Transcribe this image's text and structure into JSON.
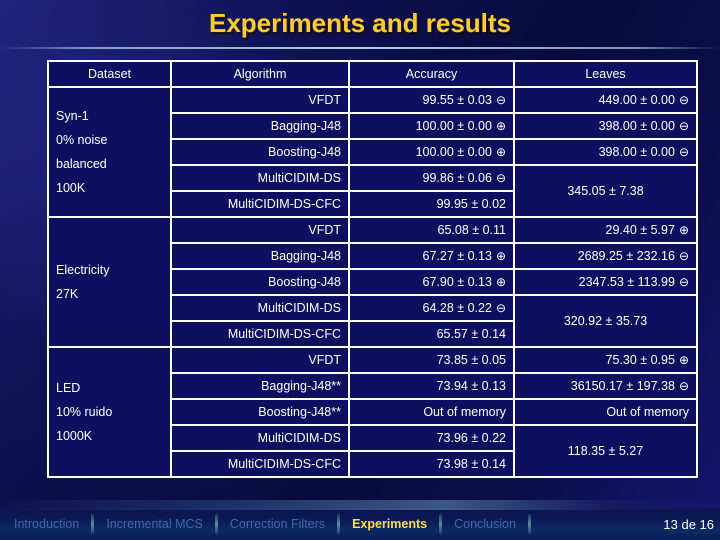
{
  "slide": {
    "title": "Experiments and results",
    "title_color": "#ffcc33",
    "background_color": "#0b0d45",
    "highlight_color": "#0b46ea"
  },
  "table": {
    "headers": [
      "Dataset",
      "Algorithm",
      "Accuracy",
      "Leaves"
    ],
    "groups": [
      {
        "dataset_lines": [
          "Syn-1",
          "0% noise",
          "balanced",
          "100K"
        ],
        "rows": [
          {
            "algorithm": "VFDT",
            "accuracy": "99.55 ± 0.03",
            "accuracy_symbol": "⊖",
            "accuracy_highlighted": false,
            "leaves": "449.00 ± 0.00",
            "leaves_symbol": "⊖"
          },
          {
            "algorithm": "Bagging-J48",
            "accuracy": "100.00 ± 0.00",
            "accuracy_symbol": "⊕",
            "accuracy_highlighted": false,
            "leaves": "398.00 ± 0.00",
            "leaves_symbol": "⊖"
          },
          {
            "algorithm": "Boosting-J48",
            "accuracy": "100.00 ± 0.00",
            "accuracy_symbol": "⊕",
            "accuracy_highlighted": false,
            "leaves": "398.00 ± 0.00",
            "leaves_symbol": "⊖"
          },
          {
            "algorithm": "MultiCIDIM-DS",
            "accuracy": "99.86 ± 0.06",
            "accuracy_symbol": "⊖",
            "accuracy_highlighted": true,
            "leaves": "",
            "leaves_symbol": ""
          },
          {
            "algorithm": "MultiCIDIM-DS-CFC",
            "accuracy": "99.95 ± 0.02",
            "accuracy_symbol": "",
            "accuracy_highlighted": true,
            "leaves": "",
            "leaves_symbol": ""
          }
        ],
        "leaves_merged": "345.05 ± 7.38"
      },
      {
        "dataset_lines": [
          "Electricity",
          "27K"
        ],
        "rows": [
          {
            "algorithm": "VFDT",
            "accuracy": "65.08 ± 0.11",
            "accuracy_symbol": "",
            "accuracy_highlighted": false,
            "leaves": "29.40 ± 5.97",
            "leaves_symbol": "⊕"
          },
          {
            "algorithm": "Bagging-J48",
            "accuracy": "67.27 ± 0.13",
            "accuracy_symbol": "⊕",
            "accuracy_highlighted": false,
            "leaves": "2689.25 ± 232.16",
            "leaves_symbol": "⊖"
          },
          {
            "algorithm": "Boosting-J48",
            "accuracy": "67.90 ± 0.13",
            "accuracy_symbol": "⊕",
            "accuracy_highlighted": false,
            "leaves": "2347.53 ± 113.99",
            "leaves_symbol": "⊖"
          },
          {
            "algorithm": "MultiCIDIM-DS",
            "accuracy": "64.28 ± 0.22",
            "accuracy_symbol": "⊖",
            "accuracy_highlighted": true,
            "leaves": "",
            "leaves_symbol": ""
          },
          {
            "algorithm": "MultiCIDIM-DS-CFC",
            "accuracy": "65.57 ± 0.14",
            "accuracy_symbol": "",
            "accuracy_highlighted": true,
            "leaves": "",
            "leaves_symbol": ""
          }
        ],
        "leaves_merged": "320.92 ± 35.73"
      },
      {
        "dataset_lines": [
          "LED",
          "10% ruido",
          "1000K"
        ],
        "rows": [
          {
            "algorithm": "VFDT",
            "accuracy": "73.85 ± 0.05",
            "accuracy_symbol": "",
            "accuracy_highlighted": false,
            "leaves": "75.30 ± 0.95",
            "leaves_symbol": "⊕"
          },
          {
            "algorithm": "Bagging-J48**",
            "accuracy": "73.94 ± 0.13",
            "accuracy_symbol": "",
            "accuracy_highlighted": false,
            "leaves": "36150.17 ± 197.38",
            "leaves_symbol": "⊖"
          },
          {
            "algorithm": "Boosting-J48**",
            "accuracy": "Out of memory",
            "accuracy_symbol": "",
            "accuracy_highlighted": false,
            "leaves": "Out of memory",
            "leaves_symbol": ""
          },
          {
            "algorithm": "MultiCIDIM-DS",
            "accuracy": "73.96 ± 0.22",
            "accuracy_symbol": "",
            "accuracy_highlighted": true,
            "leaves": "",
            "leaves_symbol": ""
          },
          {
            "algorithm": "MultiCIDIM-DS-CFC",
            "accuracy": "73.98 ± 0.14",
            "accuracy_symbol": "",
            "accuracy_highlighted": true,
            "leaves": "",
            "leaves_symbol": ""
          }
        ],
        "leaves_merged": "118.35 ± 5.27"
      }
    ]
  },
  "nav": {
    "items": [
      {
        "label": "Introduction",
        "active": false
      },
      {
        "label": "Incremental MCS",
        "active": false
      },
      {
        "label": "Correction Filters",
        "active": false
      },
      {
        "label": "Experiments",
        "active": true
      },
      {
        "label": "Conclusion",
        "active": false
      }
    ],
    "page_indicator": "13 de 16"
  }
}
